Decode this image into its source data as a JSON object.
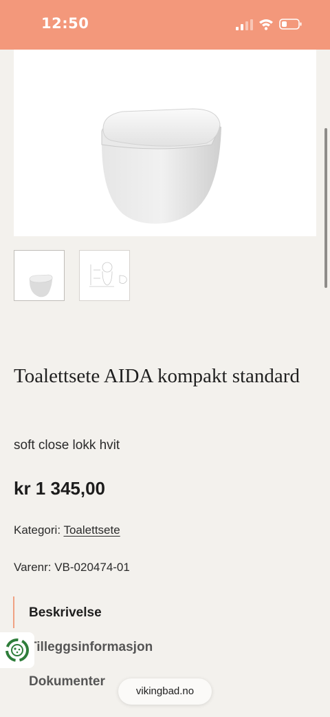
{
  "status_bar": {
    "time": "12:50",
    "icons": [
      "cellular-signal-icon",
      "wifi-icon",
      "battery-icon"
    ],
    "background": "#f3987b"
  },
  "product": {
    "title": "Toalettsete AIDA kompakt standard",
    "subtitle": "soft close lokk hvit",
    "price": "kr 1 345,00",
    "category_label": "Kategori:",
    "category_link": "Toalettsete",
    "sku": "Varenr: VB-020474-01"
  },
  "tabs": {
    "description": "Beskrivelse",
    "additional_info": "Tilleggsinformasjon",
    "documents": "Dokumenter"
  },
  "browser": {
    "url": "vikingbad.no"
  },
  "colors": {
    "accent": "#f0a182",
    "page_bg": "#f3f1ed"
  }
}
